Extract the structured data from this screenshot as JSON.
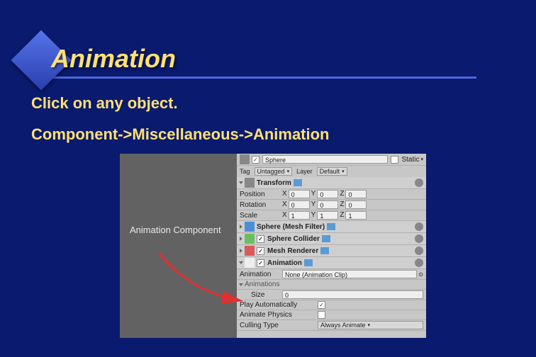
{
  "slide": {
    "title": "Animation",
    "sub1": "Click on any object.",
    "sub2": "Component->Miscellaneous->Animation",
    "annotation": "Animation Component"
  },
  "inspector": {
    "object_name": "Sphere",
    "static_label": "Static",
    "tag_label": "Tag",
    "tag_value": "Untagged",
    "layer_label": "Layer",
    "layer_value": "Default",
    "transform": {
      "header": "Transform",
      "rows": [
        {
          "label": "Position",
          "x": "0",
          "y": "0",
          "z": "0"
        },
        {
          "label": "Rotation",
          "x": "0",
          "y": "0",
          "z": "0"
        },
        {
          "label": "Scale",
          "x": "1",
          "y": "1",
          "z": "1"
        }
      ]
    },
    "components": [
      {
        "name": "Sphere (Mesh Filter)"
      },
      {
        "name": "Sphere Collider"
      },
      {
        "name": "Mesh Renderer"
      }
    ],
    "animation": {
      "header": "Animation",
      "anim_label": "Animation",
      "anim_value": "None (Animation Clip)",
      "anims_label": "Animations",
      "size_label": "Size",
      "size_value": "0",
      "play_auto": "Play Automatically",
      "animate_phys": "Animate Physics",
      "culling": "Culling Type",
      "culling_value": "Always Animate"
    }
  }
}
